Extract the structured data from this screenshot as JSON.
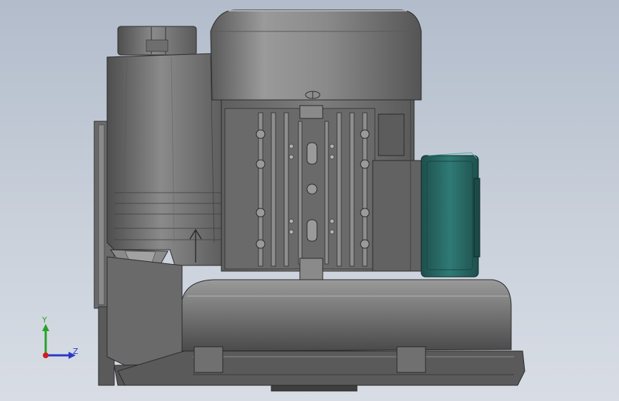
{
  "app": {
    "view": "cad-3d-viewport",
    "model": "side-channel-blower-assembly"
  },
  "triad": {
    "y_label": "Y",
    "z_label": "Z"
  },
  "colors": {
    "background_top": "#b2bccb",
    "background_bottom": "#d8dde5",
    "metal_light": "#9c9c9c",
    "metal_dark": "#4a4a4a",
    "terminal_box": "#2c6e6a",
    "axis_y": "#27a127",
    "axis_z": "#2a38c8",
    "axis_x": "#d01e1e"
  }
}
